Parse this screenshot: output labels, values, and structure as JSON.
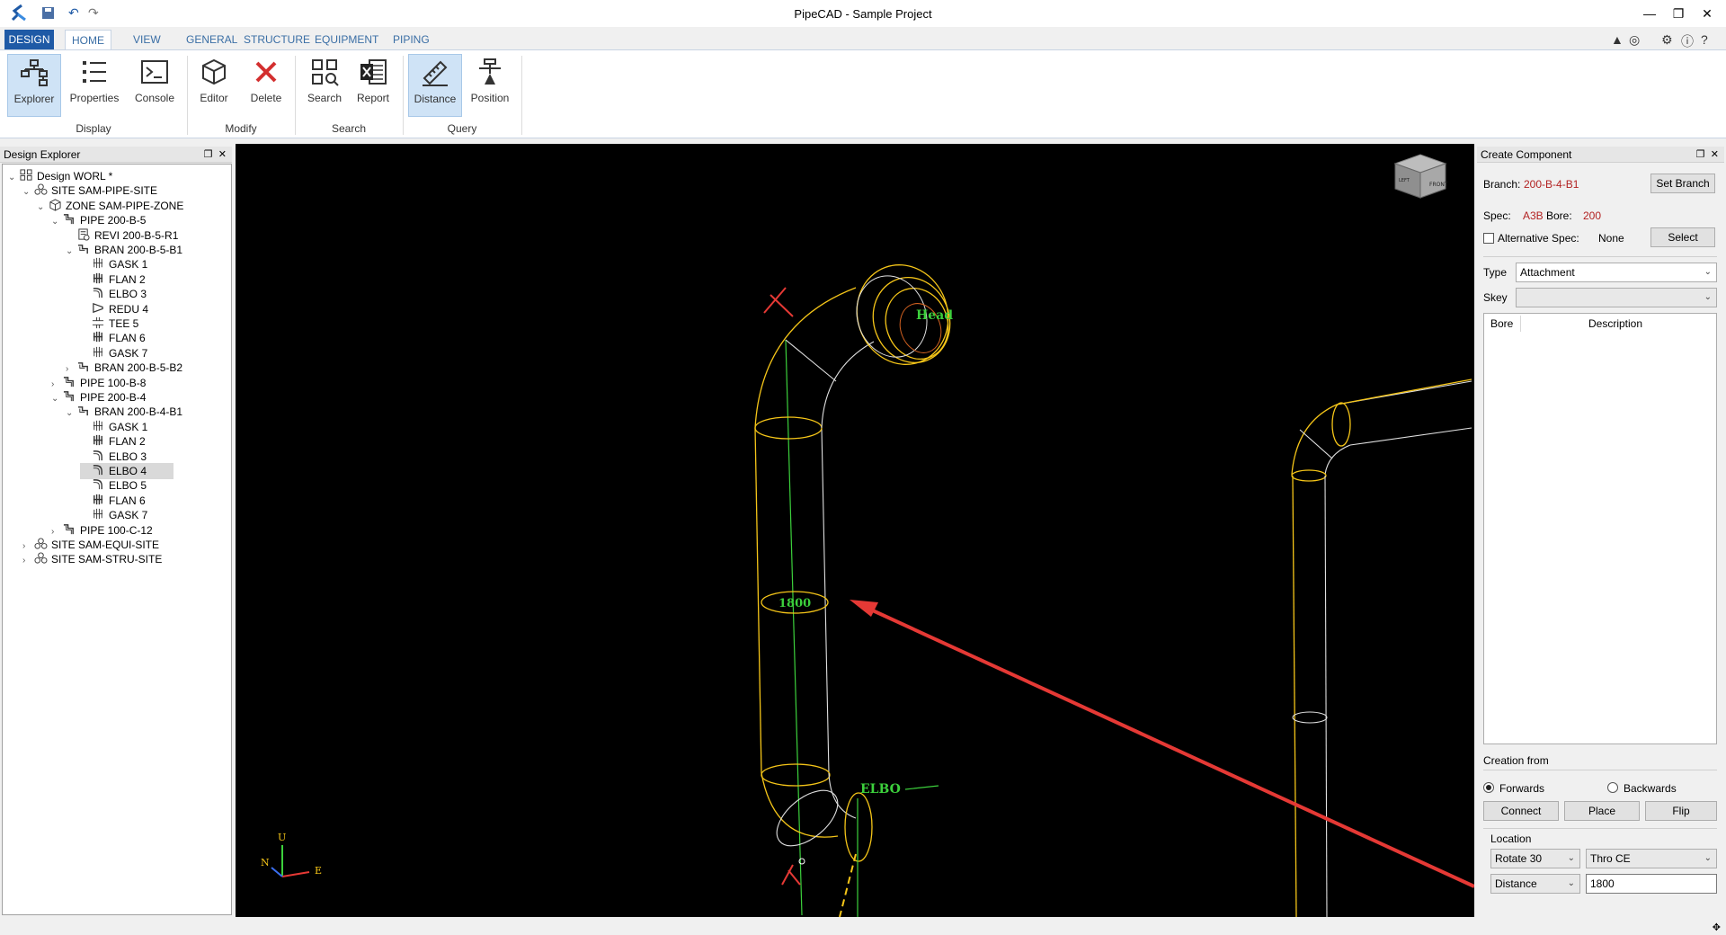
{
  "app": {
    "title": "PipeCAD - Sample Project"
  },
  "ribbon": {
    "tabs": [
      "DESIGN",
      "HOME",
      "VIEW",
      "GENERAL",
      "STRUCTURE",
      "EQUIPMENT",
      "PIPING"
    ],
    "active_tab": "HOME",
    "buttons": {
      "explorer": "Explorer",
      "properties": "Properties",
      "console": "Console",
      "editor": "Editor",
      "delete": "Delete",
      "search": "Search",
      "report": "Report",
      "distance": "Distance",
      "position": "Position"
    },
    "groups": {
      "display": "Display",
      "modify": "Modify",
      "search": "Search",
      "query": "Query"
    }
  },
  "explorer": {
    "title": "Design Explorer",
    "tree": [
      {
        "label": "Design WORL *",
        "icon": "world-icon",
        "expanded": true,
        "level": 0
      },
      {
        "label": "SITE SAM-PIPE-SITE",
        "icon": "site-icon",
        "expanded": true,
        "level": 1
      },
      {
        "label": "ZONE SAM-PIPE-ZONE",
        "icon": "zone-icon",
        "expanded": true,
        "level": 2
      },
      {
        "label": "PIPE 200-B-5",
        "icon": "pipe-icon",
        "expanded": true,
        "level": 3
      },
      {
        "label": "REVI 200-B-5-R1",
        "icon": "revi-icon",
        "level": 4
      },
      {
        "label": "BRAN 200-B-5-B1",
        "icon": "branch-icon",
        "expanded": true,
        "level": 4
      },
      {
        "label": "GASK 1",
        "icon": "gasket-icon",
        "level": 5
      },
      {
        "label": "FLAN 2",
        "icon": "flange-icon",
        "level": 5
      },
      {
        "label": "ELBO 3",
        "icon": "elbow-icon",
        "level": 5
      },
      {
        "label": "REDU 4",
        "icon": "reducer-icon",
        "level": 5
      },
      {
        "label": "TEE 5",
        "icon": "tee-icon",
        "level": 5
      },
      {
        "label": "FLAN 6",
        "icon": "flange-icon",
        "level": 5
      },
      {
        "label": "GASK 7",
        "icon": "gasket-icon",
        "level": 5
      },
      {
        "label": "BRAN 200-B-5-B2",
        "icon": "branch-icon",
        "expanded": false,
        "level": 4
      },
      {
        "label": "PIPE 100-B-8",
        "icon": "pipe-icon",
        "expanded": false,
        "level": 3
      },
      {
        "label": "PIPE 200-B-4",
        "icon": "pipe-icon",
        "expanded": true,
        "level": 3
      },
      {
        "label": "BRAN 200-B-4-B1",
        "icon": "branch-icon",
        "expanded": true,
        "level": 4
      },
      {
        "label": "GASK 1",
        "icon": "gasket-icon",
        "level": 5
      },
      {
        "label": "FLAN 2",
        "icon": "flange-icon",
        "level": 5
      },
      {
        "label": "ELBO 3",
        "icon": "elbow-icon",
        "level": 5
      },
      {
        "label": "ELBO 4",
        "icon": "elbow-icon",
        "level": 5,
        "selected": true
      },
      {
        "label": "ELBO 5",
        "icon": "elbow-icon",
        "level": 5
      },
      {
        "label": "FLAN 6",
        "icon": "flange-icon",
        "level": 5
      },
      {
        "label": "GASK 7",
        "icon": "gasket-icon",
        "level": 5
      },
      {
        "label": "PIPE 100-C-12",
        "icon": "pipe-icon",
        "expanded": false,
        "level": 3
      },
      {
        "label": "SITE SAM-EQUI-SITE",
        "icon": "site-icon",
        "expanded": false,
        "level": 1
      },
      {
        "label": "SITE SAM-STRU-SITE",
        "icon": "site-icon",
        "expanded": false,
        "level": 1
      }
    ]
  },
  "viewport": {
    "labels": {
      "dimension": "1800",
      "head": "Head",
      "elbo": "ELBO"
    },
    "axes": {
      "up": "U",
      "north": "N",
      "east": "E"
    },
    "viewcube": {
      "front": "FRONT",
      "left": "LEFT"
    }
  },
  "create_component": {
    "title": "Create Component",
    "branch_label": "Branch:",
    "branch_value": "200-B-4-B1",
    "set_branch": "Set Branch",
    "spec_label": "Spec:",
    "spec_value": "A3B",
    "bore_label": "Bore:",
    "bore_value": "200",
    "alt_spec_label": "Alternative Spec:",
    "alt_spec_value": "None",
    "select": "Select",
    "type_label": "Type",
    "type_value": "Attachment",
    "skey_label": "Skey",
    "skey_value": "",
    "columns": [
      "Bore",
      "Description"
    ],
    "creation_from": "Creation from",
    "forwards": "Forwards",
    "backwards": "Backwards",
    "connect": "Connect",
    "place": "Place",
    "flip": "Flip",
    "location": "Location",
    "rotate_value": "Rotate 30",
    "thro_value": "Thro CE",
    "distance_mode": "Distance",
    "distance_value": "1800"
  },
  "colors": {
    "design_tab": "#1f5aa6",
    "pipe_yellow": "#f5c518",
    "center_green": "#3cd03c",
    "arrow_red": "#e53935"
  }
}
